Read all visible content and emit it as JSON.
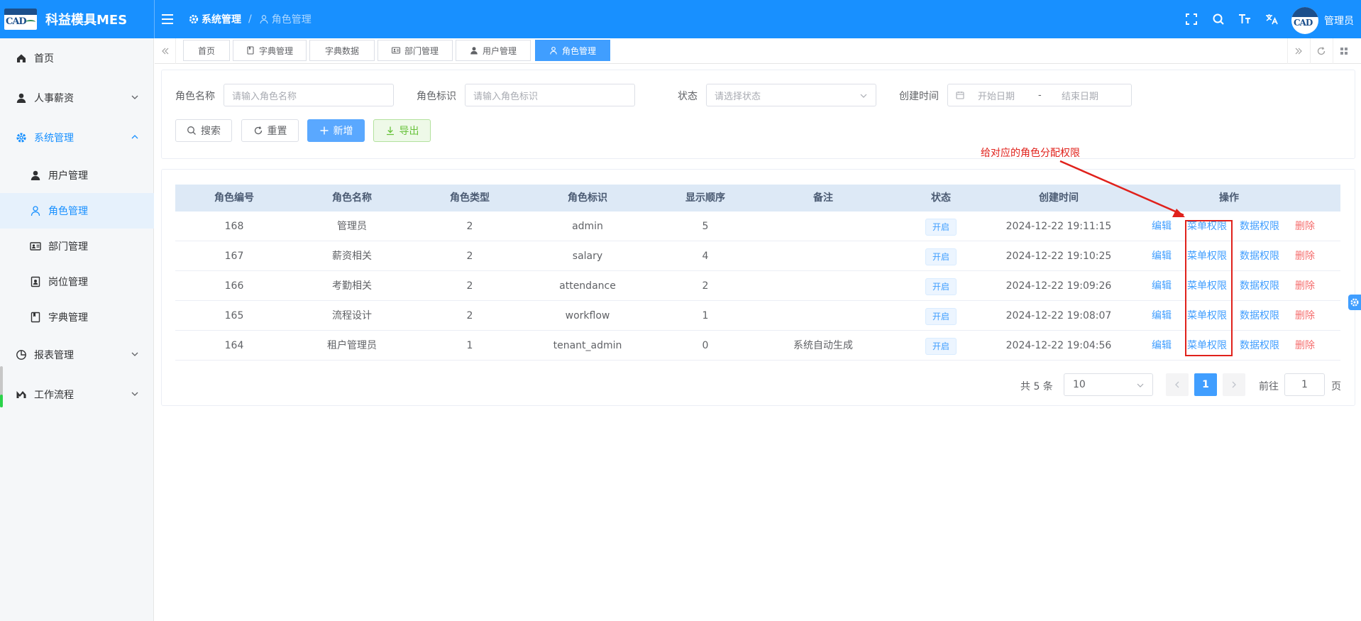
{
  "app": {
    "title": "科益模具MES",
    "logo_text": "CAD",
    "username": "管理员"
  },
  "breadcrumb": {
    "parent": "系统管理",
    "current": "角色管理"
  },
  "sidebar": {
    "items": [
      {
        "label": "首页",
        "icon": "home-icon"
      },
      {
        "label": "人事薪资",
        "icon": "user-icon"
      },
      {
        "label": "系统管理",
        "icon": "gear-icon"
      },
      {
        "label": "用户管理",
        "icon": "user-icon"
      },
      {
        "label": "角色管理",
        "icon": "user-outline-icon"
      },
      {
        "label": "部门管理",
        "icon": "id-card-icon"
      },
      {
        "label": "岗位管理",
        "icon": "badge-icon"
      },
      {
        "label": "字典管理",
        "icon": "book-icon"
      },
      {
        "label": "报表管理",
        "icon": "pie-chart-icon"
      },
      {
        "label": "工作流程",
        "icon": "flow-icon"
      }
    ]
  },
  "tabs": [
    {
      "label": "首页"
    },
    {
      "label": "字典管理"
    },
    {
      "label": "字典数据"
    },
    {
      "label": "部门管理"
    },
    {
      "label": "用户管理"
    },
    {
      "label": "角色管理"
    }
  ],
  "filters": {
    "role_name_label": "角色名称",
    "role_name_placeholder": "请输入角色名称",
    "role_key_label": "角色标识",
    "role_key_placeholder": "请输入角色标识",
    "status_label": "状态",
    "status_placeholder": "请选择状态",
    "created_label": "创建时间",
    "start_placeholder": "开始日期",
    "range_sep": "-",
    "end_placeholder": "结束日期"
  },
  "buttons": {
    "search": "搜索",
    "reset": "重置",
    "add": "新增",
    "export": "导出"
  },
  "table": {
    "headers": [
      "角色编号",
      "角色名称",
      "角色类型",
      "角色标识",
      "显示顺序",
      "备注",
      "状态",
      "创建时间",
      "操作"
    ],
    "rows": [
      {
        "id": "168",
        "name": "管理员",
        "type": "2",
        "key": "admin",
        "order": "5",
        "remark": "",
        "status": "开启",
        "created": "2024-12-22 19:11:15"
      },
      {
        "id": "167",
        "name": "薪资相关",
        "type": "2",
        "key": "salary",
        "order": "4",
        "remark": "",
        "status": "开启",
        "created": "2024-12-22 19:10:25"
      },
      {
        "id": "166",
        "name": "考勤相关",
        "type": "2",
        "key": "attendance",
        "order": "2",
        "remark": "",
        "status": "开启",
        "created": "2024-12-22 19:09:26"
      },
      {
        "id": "165",
        "name": "流程设计",
        "type": "2",
        "key": "workflow",
        "order": "1",
        "remark": "",
        "status": "开启",
        "created": "2024-12-22 19:08:07"
      },
      {
        "id": "164",
        "name": "租户管理员",
        "type": "1",
        "key": "tenant_admin",
        "order": "0",
        "remark": "系统自动生成",
        "status": "开启",
        "created": "2024-12-22 19:04:56"
      }
    ],
    "actions": {
      "edit": "编辑",
      "menu_perm": "菜单权限",
      "data_perm": "数据权限",
      "delete": "删除"
    }
  },
  "pagination": {
    "total": "共 5 条",
    "page_size": "10",
    "current_page": "1",
    "goto_label": "前往",
    "goto_value": "1",
    "page_suffix": "页"
  },
  "annotation": {
    "text": "给对应的角色分配权限"
  },
  "colors": {
    "primary": "#1890ff",
    "accent": "#409eff",
    "danger": "#f56c6c",
    "annotation": "#e0211b"
  }
}
